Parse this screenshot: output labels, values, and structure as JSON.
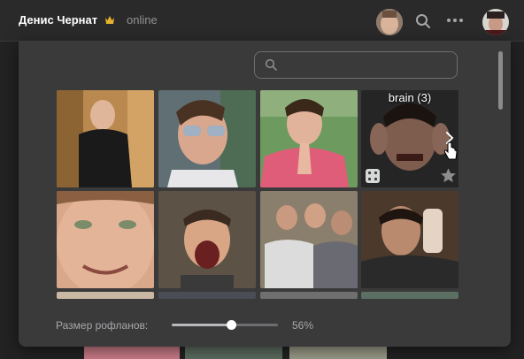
{
  "header": {
    "peer_name": "Денис Чернат",
    "status": "online",
    "icons": [
      "crown-icon",
      "search-icon",
      "more-icon"
    ]
  },
  "search": {
    "placeholder": "",
    "value": ""
  },
  "grid": {
    "hover_title": "brain (3)",
    "hover_icons": [
      "dice-icon",
      "star-icon",
      "chevron-right-icon",
      "hand-cursor-icon"
    ]
  },
  "size_control": {
    "label": "Размер рофланов:",
    "value_text": "56%",
    "value": 0.56
  },
  "colors": {
    "panel_bg": "#3a3a3b",
    "header_bg": "#2a2a2b",
    "page_bg": "#222222",
    "text_primary": "#ffffff",
    "text_secondary": "#939393"
  }
}
